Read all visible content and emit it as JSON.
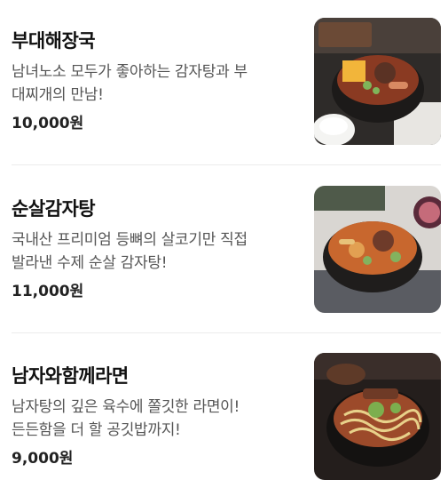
{
  "menu": {
    "items": [
      {
        "name": "부대해장국",
        "description_line1": "남녀노소 모두가 좋아하는 감자탕과 부",
        "description_line2": "대찌개의 만남!",
        "price": "10,000원",
        "image_icon": "budae-stew-photo"
      },
      {
        "name": "순살감자탕",
        "description_line1": "국내산 프리미엄 등뼈의 살코기만 직접",
        "description_line2": "발라낸 수제 순살 감자탕!",
        "price": "11,000원",
        "image_icon": "boneless-gamjatang-photo"
      },
      {
        "name": "남자와함께라면",
        "description_line1": "남자탕의 깊은 육수에 쫄깃한 라면이!",
        "description_line2": "든든함을 더 할 공깃밥까지!",
        "price": "9,000원",
        "image_icon": "ramen-stew-photo"
      }
    ]
  }
}
